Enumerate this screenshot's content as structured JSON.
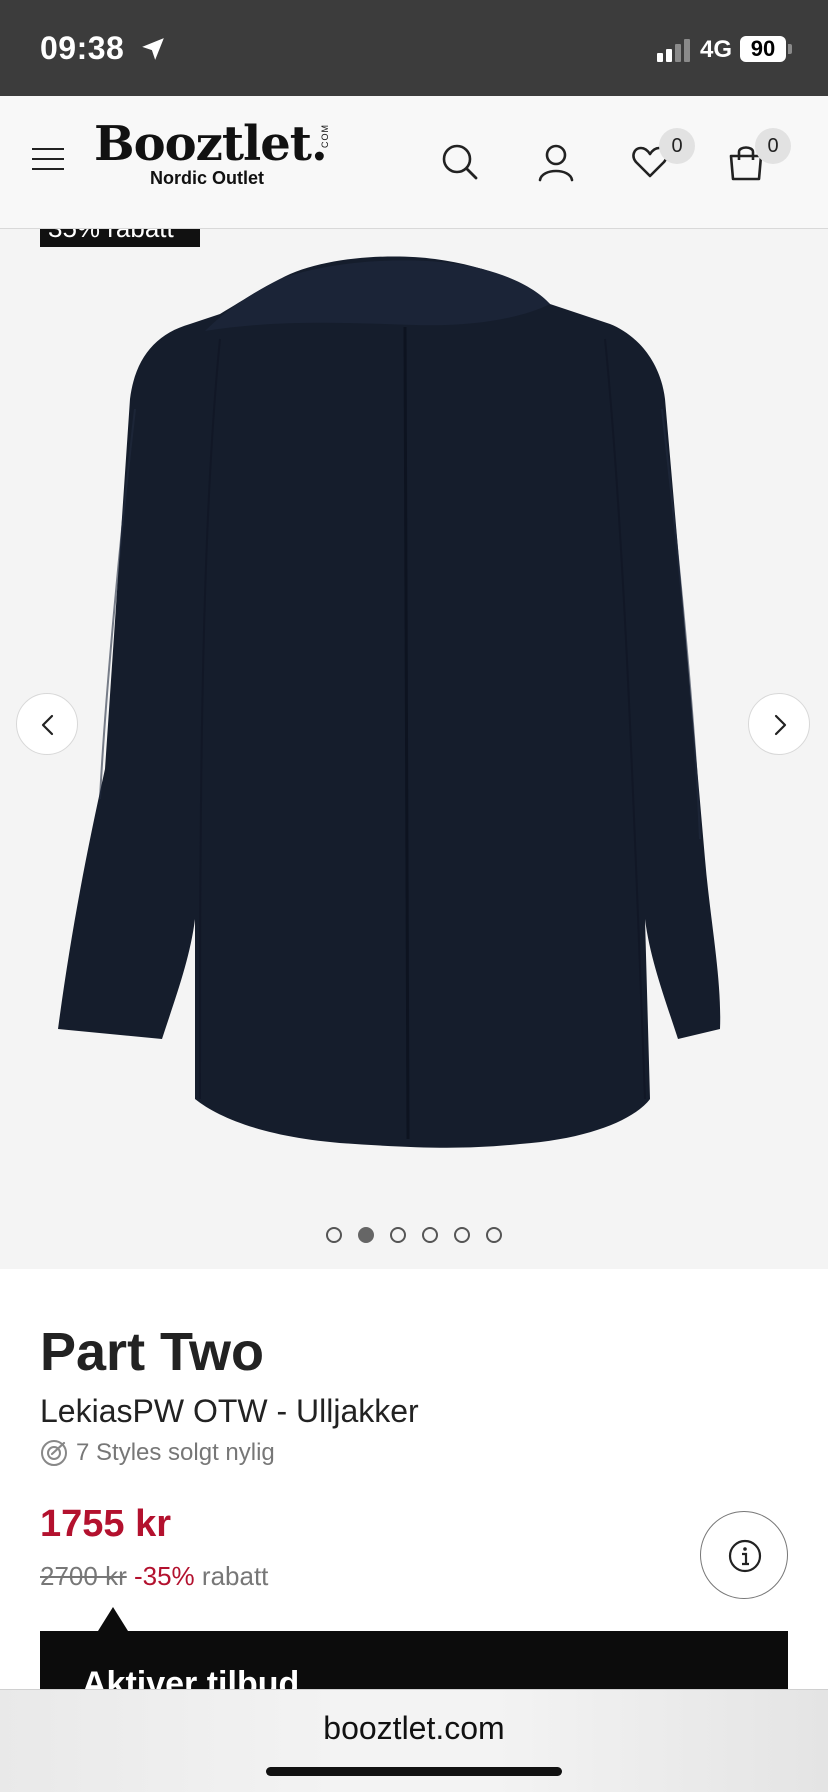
{
  "status": {
    "time": "09:38",
    "network": "4G",
    "battery": "90"
  },
  "header": {
    "logo_main": "Booztlet.",
    "logo_com": "COM",
    "logo_sub": "Nordic Outlet",
    "wishlist_count": "0",
    "cart_count": "0",
    "icons": [
      "menu-icon",
      "search-icon",
      "user-icon",
      "heart-icon",
      "shopping-bag-icon"
    ]
  },
  "gallery": {
    "discount_tag": "35% rabatt",
    "image_count": 6,
    "active_index": 1
  },
  "product": {
    "brand": "Part Two",
    "name": "LekiasPW OTW - Ulljakker",
    "sold_recently": "7 Styles solgt nylig",
    "price": "1755 kr",
    "old_price": "2700 kr",
    "discount_pct": "-35%",
    "discount_word": "rabatt",
    "offer_button": "Aktiver tilbud"
  },
  "browser": {
    "url": "booztlet.com"
  },
  "colors": {
    "accent_red": "#b3112e",
    "coat_navy": "#151d2c",
    "status_bar": "#3c3c3c"
  }
}
